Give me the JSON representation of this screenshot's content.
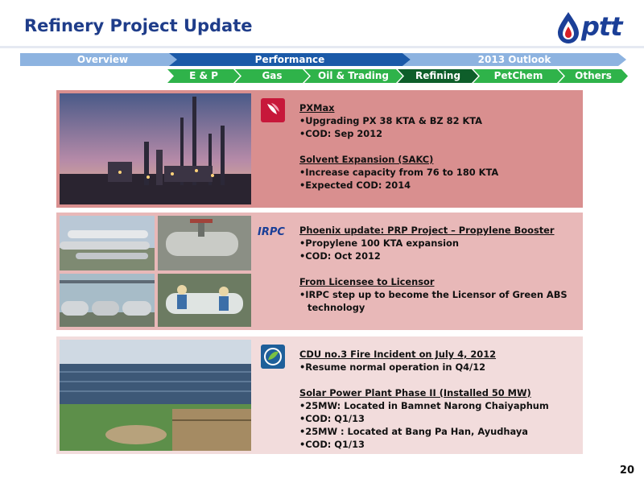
{
  "header": {
    "title": "Refinery Project Update",
    "logo_text": "ptt"
  },
  "nav": {
    "main": [
      {
        "label": "Overview",
        "active": false
      },
      {
        "label": "Performance",
        "active": true
      },
      {
        "label": "2013 Outlook",
        "active": false
      }
    ],
    "sub": [
      {
        "label": "E & P",
        "active": false
      },
      {
        "label": "Gas",
        "active": false
      },
      {
        "label": "Oil & Trading",
        "active": false
      },
      {
        "label": "Refining",
        "active": true
      },
      {
        "label": "PetChem",
        "active": false
      },
      {
        "label": "Others",
        "active": false
      }
    ]
  },
  "panels": [
    {
      "icon": "thaioil-logo-icon",
      "icon_text": "Thaioil",
      "sections": [
        {
          "heading": "PXMax",
          "bullets": [
            "Upgrading PX 38 KTA & BZ 82 KTA",
            "COD: Sep 2012"
          ]
        },
        {
          "heading": "Solvent Expansion (SAKC)",
          "bullets": [
            "Increase capacity from 76 to 180 KTA",
            "Expected COD: 2014"
          ]
        }
      ]
    },
    {
      "icon": "irpc-logo-icon",
      "icon_text": "IRPC",
      "sections": [
        {
          "heading": "Phoenix update: PRP Project – Propylene Booster",
          "bullets": [
            "Propylene 100 KTA expansion",
            "COD: Oct 2012"
          ]
        },
        {
          "heading": "From Licensee to Licensor",
          "bullets": [
            "IRPC step up to become the Licensor of Green ABS technology"
          ]
        }
      ]
    },
    {
      "icon": "bangchak-logo-icon",
      "icon_text": "",
      "sections": [
        {
          "heading": "CDU no.3 Fire Incident on July 4, 2012",
          "bullets": [
            "Resume normal operation in Q4/12"
          ]
        },
        {
          "heading": "Solar Power Plant Phase II (Installed 50 MW)",
          "bullets": [
            "25MW: Located in Bamnet Narong Chaiyaphum",
            "COD: Q1/13",
            "25MW : Located at Bang Pa Han, Ayudhaya",
            "COD: Q1/13"
          ]
        }
      ]
    }
  ],
  "page_number": "20",
  "colors": {
    "title": "#1f3d8a",
    "nav_main": "#8db3e0",
    "nav_main_active": "#1b5aa8",
    "nav_sub": "#2fb34a",
    "nav_sub_active": "#0e5e2a",
    "panel1": "#d98f8f",
    "panel2": "#e8b8b8",
    "panel3": "#f2dcdc"
  }
}
